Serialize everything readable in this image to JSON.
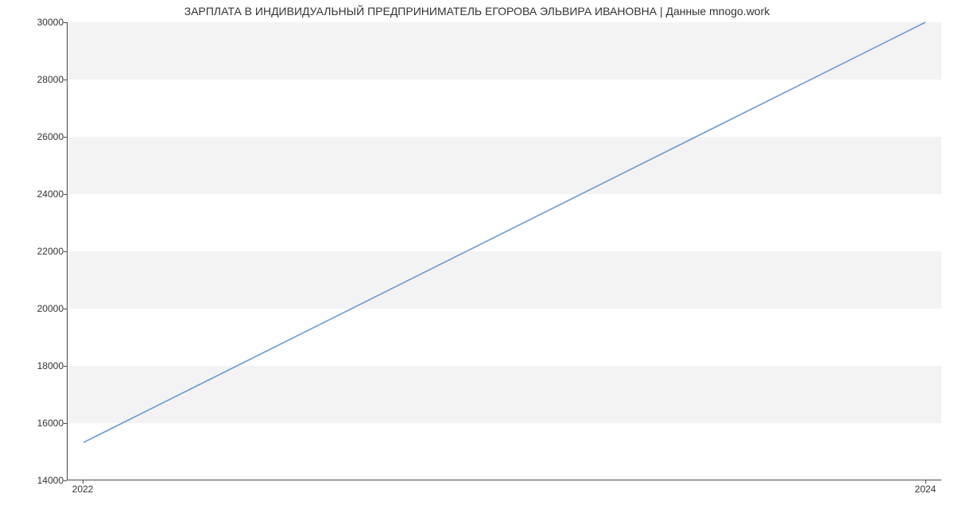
{
  "chart_data": {
    "type": "line",
    "title": "ЗАРПЛАТА В ИНДИВИДУАЛЬНЫЙ ПРЕДПРИНИМАТЕЛЬ ЕГОРОВА ЭЛЬВИРА ИВАНОВНА | Данные mnogo.work",
    "xlabel": "",
    "ylabel": "",
    "x": [
      2022,
      2024
    ],
    "values": [
      15300,
      30000
    ],
    "x_ticks": [
      2022,
      2024
    ],
    "y_ticks": [
      14000,
      16000,
      18000,
      20000,
      22000,
      24000,
      26000,
      28000,
      30000
    ],
    "xlim": [
      2022,
      2024
    ],
    "ylim": [
      14000,
      30000
    ],
    "line_color": "#6a98e0",
    "grid_band_color": "#f3f3f3",
    "axis_color": "#4a4a4a"
  }
}
